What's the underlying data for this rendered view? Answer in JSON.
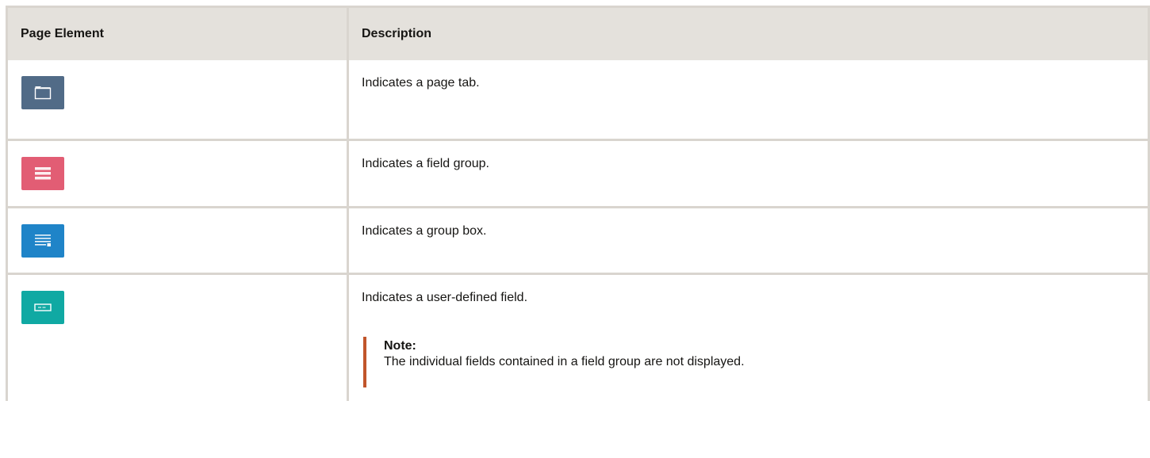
{
  "table": {
    "headers": [
      "Page Element",
      "Description"
    ],
    "rows": [
      {
        "icon": "page-tab-icon",
        "color": "#516b87",
        "description": "Indicates a page tab."
      },
      {
        "icon": "field-group-icon",
        "color": "#e25d74",
        "description": "Indicates a field group."
      },
      {
        "icon": "group-box-icon",
        "color": "#1f84c8",
        "description": "Indicates a group box."
      },
      {
        "icon": "user-defined-field-icon",
        "color": "#10a9a3",
        "description": "Indicates a user-defined field."
      }
    ]
  },
  "note": {
    "title": "Note:",
    "text": "The individual fields contained in a field group are not displayed."
  },
  "colors": {
    "header_bg": "#e4e1dc",
    "border": "#d9d5cf",
    "note_accent": "#c1552b"
  }
}
